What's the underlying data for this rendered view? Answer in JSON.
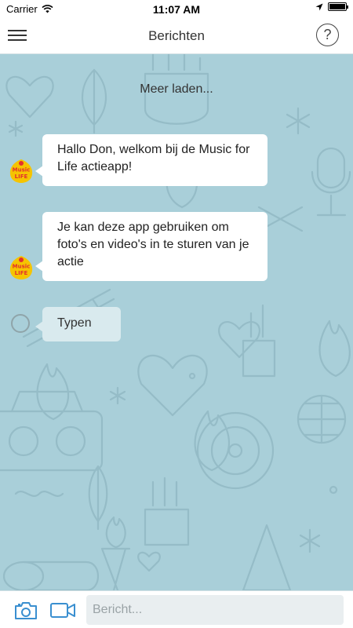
{
  "status_bar": {
    "carrier": "Carrier",
    "time": "11:07 AM"
  },
  "nav": {
    "title": "Berichten",
    "help_label": "?"
  },
  "chat": {
    "load_more": "Meer laden...",
    "messages": [
      {
        "sender": "Music for Life",
        "text": "Hallo Don, welkom bij de Music for Life actieapp!"
      },
      {
        "sender": "Music for Life",
        "text": "Je kan deze app gebruiken om foto's en video's in te sturen van je actie"
      }
    ],
    "typing_label": "Typen",
    "avatar_logo": {
      "top": "Music",
      "bottom": "LIFE"
    }
  },
  "input": {
    "placeholder": "Bericht..."
  },
  "colors": {
    "background": "#a9cfd9",
    "bubble": "#ffffff",
    "accent": "#3a8fd0",
    "logo_yellow": "#f5c400",
    "logo_red": "#e3312d"
  },
  "icons": {
    "menu": "hamburger-menu-icon",
    "help": "help-circle-icon",
    "camera": "camera-icon",
    "video": "video-camera-icon",
    "wifi": "wifi-icon",
    "location": "location-arrow-icon",
    "battery": "battery-icon"
  }
}
